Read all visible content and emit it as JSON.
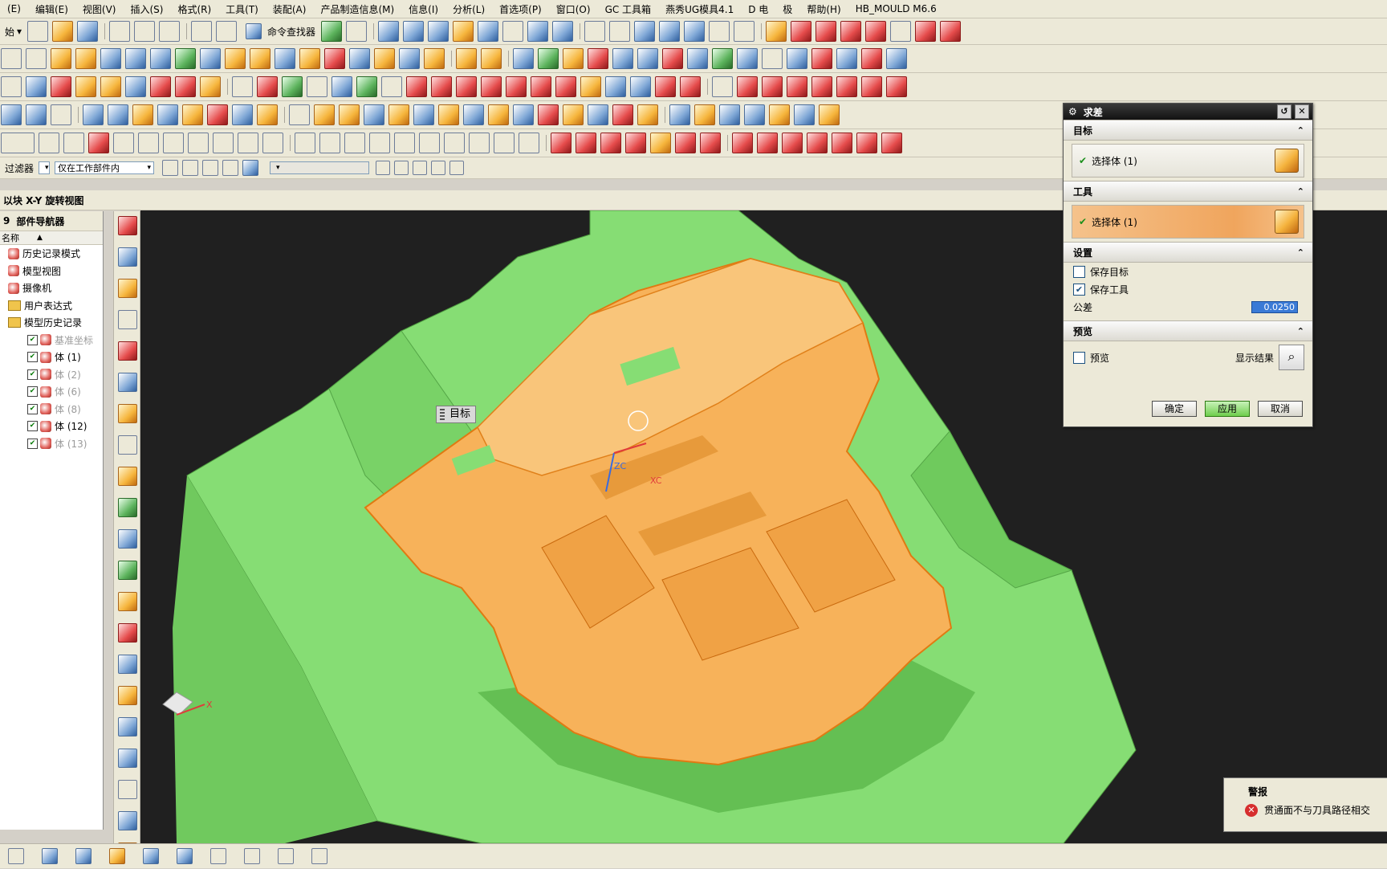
{
  "menu": [
    "(E)",
    "编辑(E)",
    "视图(V)",
    "插入(S)",
    "格式(R)",
    "工具(T)",
    "装配(A)",
    "产品制造信息(M)",
    "信息(I)",
    "分析(L)",
    "首选项(P)",
    "窗口(O)",
    "GC 工具箱",
    "燕秀UG模具4.1",
    "D 电",
    "极",
    "帮助(H)",
    "HB_MOULD M6.6"
  ],
  "toolbar": {
    "start_label": "始",
    "command_finder": "命令查找器",
    "filter_label": "过滤器",
    "scope_combo": "仅在工作部件内",
    "snap_label": "以块 X-Y 旋转视图"
  },
  "navigator": {
    "title": "部件导航器",
    "column": "名称",
    "items": [
      {
        "label": "历史记录模式",
        "kind": "clock",
        "grey": false
      },
      {
        "label": "模型视图",
        "kind": "views",
        "grey": false
      },
      {
        "label": "摄像机",
        "kind": "camera",
        "grey": false
      },
      {
        "label": "用户表达式",
        "kind": "folder",
        "grey": false
      },
      {
        "label": "模型历史记录",
        "kind": "folder",
        "grey": false
      },
      {
        "label": "基准坐标",
        "kind": "body",
        "grey": true
      },
      {
        "label": "体 (1)",
        "kind": "body",
        "grey": false
      },
      {
        "label": "体 (2)",
        "kind": "body",
        "grey": true
      },
      {
        "label": "体 (6)",
        "kind": "body",
        "grey": true
      },
      {
        "label": "体 (8)",
        "kind": "body",
        "grey": true
      },
      {
        "label": "体 (12)",
        "kind": "body",
        "grey": false
      },
      {
        "label": "体 (13)",
        "kind": "body",
        "grey": true
      }
    ]
  },
  "viewport": {
    "tooltip": "目标",
    "axis_zc": "ZC",
    "axis_xc": "XC",
    "triad_x": "X"
  },
  "dialog": {
    "title": "求差",
    "target_section": "目标",
    "target_select": "选择体 (1)",
    "tool_section": "工具",
    "tool_select": "选择体 (1)",
    "settings_section": "设置",
    "keep_target": "保存目标",
    "keep_target_checked": false,
    "keep_tool": "保存工具",
    "keep_tool_checked": true,
    "tolerance_label": "公差",
    "tolerance_value": "0.0250",
    "preview_section": "预览",
    "preview_label": "预览",
    "show_result": "显示结果",
    "ok": "确定",
    "apply": "应用",
    "cancel": "取消"
  },
  "alert": {
    "title": "警报",
    "message": "贯通面不与刀具路径相交"
  },
  "colors": {
    "mold_green": "#86dd74",
    "part_orange": "#f7b25a",
    "background": "#202020"
  }
}
